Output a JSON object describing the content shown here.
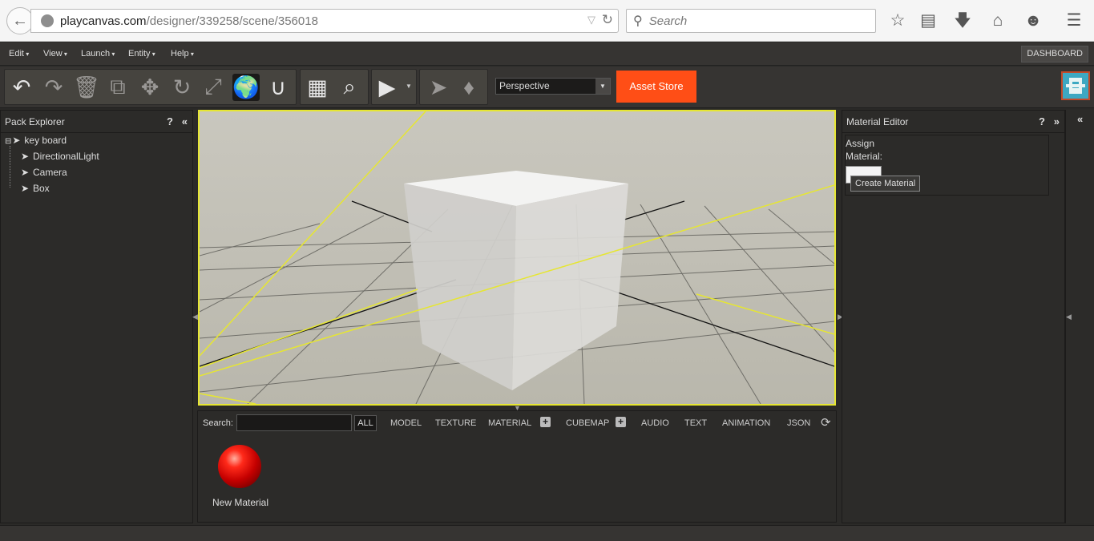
{
  "browser": {
    "url_host": "playcanvas.com",
    "url_path": "/designer/339258/scene/356018",
    "search_placeholder": "Search"
  },
  "menubar": {
    "items": [
      "Edit",
      "View",
      "Launch",
      "Entity",
      "Help"
    ],
    "dashboard_label": "DASHBOARD"
  },
  "toolbar": {
    "camera_mode": "Perspective",
    "asset_store_label": "Asset Store"
  },
  "pack_explorer": {
    "title": "Pack Explorer",
    "help": "?",
    "collapse": "«",
    "root": "key board",
    "children": [
      "DirectionalLight",
      "Camera",
      "Box"
    ]
  },
  "assets": {
    "search_label": "Search:",
    "search_value": "",
    "filters": [
      "ALL",
      "MODEL",
      "TEXTURE",
      "MATERIAL",
      "CUBEMAP",
      "AUDIO",
      "TEXT",
      "ANIMATION",
      "JSON"
    ],
    "items": [
      {
        "name": "New Material",
        "color": "#ff2a1a"
      }
    ]
  },
  "material_editor": {
    "title": "Material Editor",
    "help": "?",
    "expand": "»",
    "assign_label": "Assign Material:",
    "tooltip": "Create Material"
  },
  "colors": {
    "accent": "#ff4e16",
    "viewport_outline": "#e6e632"
  }
}
